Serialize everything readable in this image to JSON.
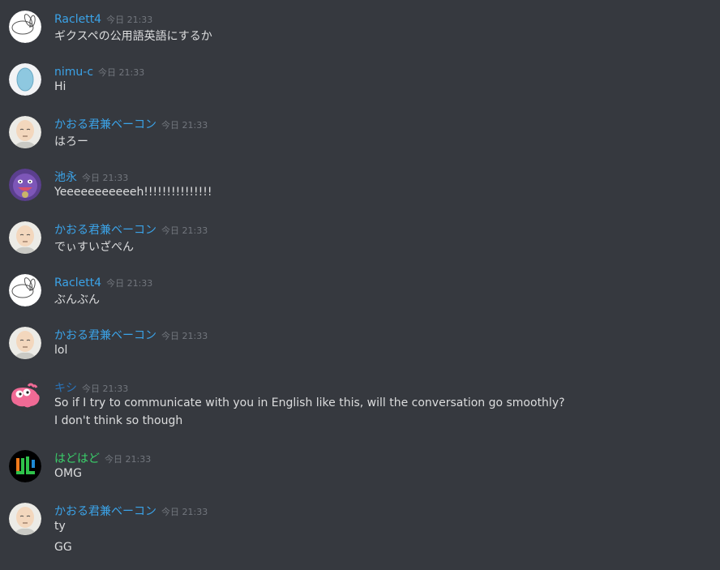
{
  "colors": {
    "background": "#36393f",
    "message_text": "#dcddde",
    "timestamp": "#72767d"
  },
  "messages": [
    {
      "author": "Raclett4",
      "author_color": "#3ba3e8",
      "timestamp": "今日 21:33",
      "avatar": "white-bunny-avatar",
      "lines": [
        "ギクスペの公用語英語にするか"
      ]
    },
    {
      "author": "nimu-c",
      "author_color": "#3ba3e8",
      "timestamp": "今日 21:33",
      "avatar": "blue-oval-avatar",
      "lines": [
        "Hi"
      ]
    },
    {
      "author": "かおる君兼ベーコン",
      "author_color": "#3ba3e8",
      "timestamp": "今日 21:33",
      "avatar": "bald-hero-avatar",
      "lines": [
        "はろー"
      ]
    },
    {
      "author": "池永",
      "author_color": "#3ba3e8",
      "timestamp": "今日 21:33",
      "avatar": "purple-ghost-avatar",
      "lines": [
        "Yeeeeeeeeeeeh!!!!!!!!!!!!!!!"
      ]
    },
    {
      "author": "かおる君兼ベーコン",
      "author_color": "#3ba3e8",
      "timestamp": "今日 21:33",
      "avatar": "bald-hero-avatar",
      "lines": [
        "でぃすいざぺん"
      ]
    },
    {
      "author": "Raclett4",
      "author_color": "#3ba3e8",
      "timestamp": "今日 21:33",
      "avatar": "white-bunny-avatar",
      "lines": [
        "ぶんぶん"
      ]
    },
    {
      "author": "かおる君兼ベーコン",
      "author_color": "#3ba3e8",
      "timestamp": "今日 21:33",
      "avatar": "bald-hero-avatar",
      "lines": [
        "lol"
      ]
    },
    {
      "author": "キシ",
      "author_color": "#2a73b8",
      "timestamp": "今日 21:33",
      "avatar": "pink-creature-avatar",
      "lines": [
        "So if I try to communicate with you in English like this, will the conversation go smoothly?",
        "I don't think so though"
      ]
    },
    {
      "author": "はどはど",
      "author_color": "#3ad16a",
      "timestamp": "今日 21:33",
      "avatar": "green-logo-avatar",
      "lines": [
        "OMG"
      ]
    },
    {
      "author": "かおる君兼ベーコン",
      "author_color": "#3ba3e8",
      "timestamp": "今日 21:33",
      "avatar": "bald-hero-avatar",
      "lines": [
        "ty",
        "GG"
      ]
    }
  ]
}
